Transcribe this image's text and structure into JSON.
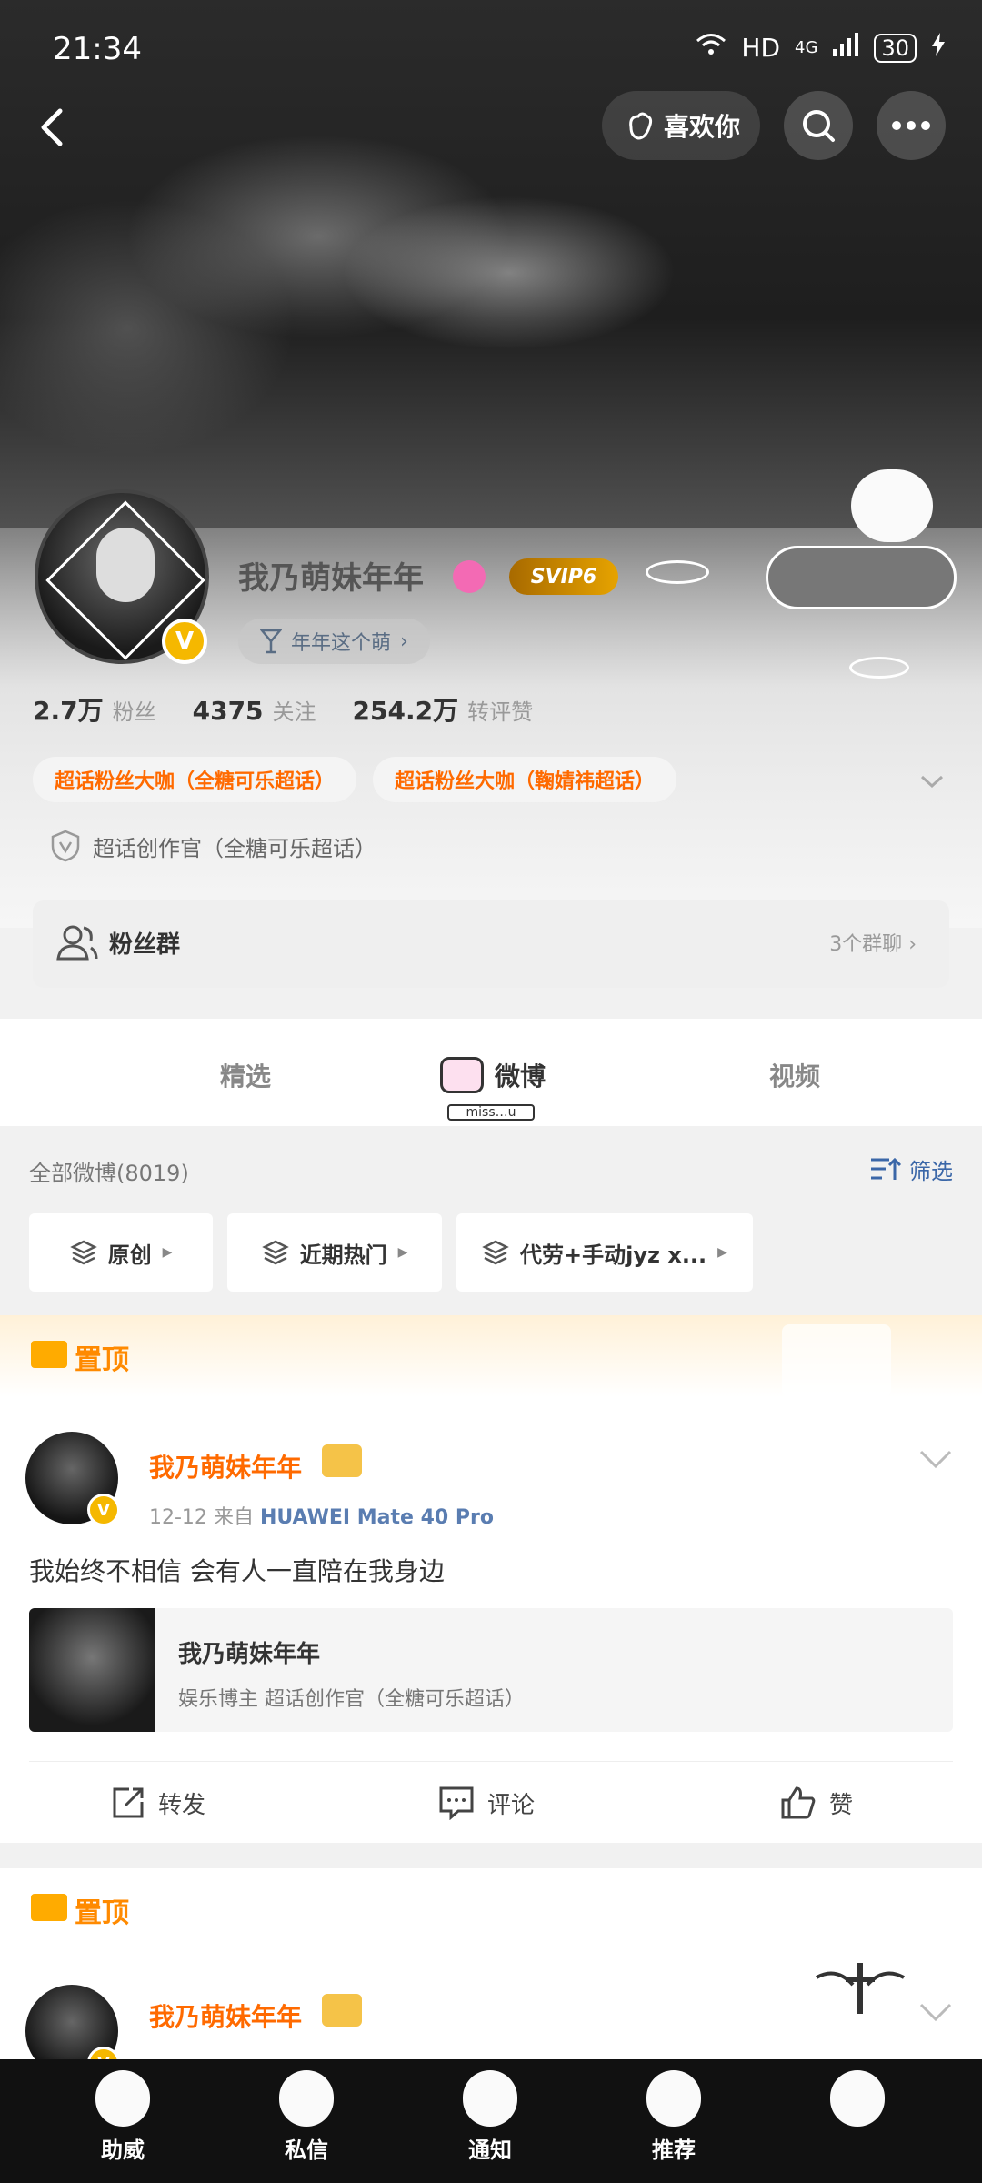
{
  "status_bar": {
    "time": "21:34",
    "network": "HD",
    "signal": "4G",
    "battery": "30"
  },
  "top_bar": {
    "like_label": "喜欢你"
  },
  "profile": {
    "name": "我乃萌妹年年",
    "vip_badge": "SVIP6",
    "signature": "年年这个萌",
    "stats": [
      {
        "value": "2.7万",
        "label": "粉丝"
      },
      {
        "value": "4375",
        "label": "关注"
      },
      {
        "value": "254.2万",
        "label": "转评赞"
      }
    ],
    "chips": [
      "超话粉丝大咖（全糖可乐超话）",
      "超话粉丝大咖（鞠婧祎超话）"
    ],
    "creator": "超话创作官（全糖可乐超话）"
  },
  "fan_group": {
    "title": "粉丝群",
    "count": "3个群聊"
  },
  "tabs": {
    "featured": "精选",
    "weibo": "微博",
    "video": "视频",
    "weibo_tag": "miss…u"
  },
  "filter": {
    "all_posts": "全部微博(8019)",
    "filter_label": "筛选",
    "buttons": [
      "原创",
      "近期热门",
      "代劳+手动jyz x..."
    ]
  },
  "posts": [
    {
      "pin_label": "置顶",
      "author": "我乃萌妹年年",
      "date": "12-12",
      "from_label": "来自",
      "device": "HUAWEI Mate 40 Pro",
      "text": "我始终不相信 会有人一直陪在我身边",
      "quote_title": "我乃萌妹年年",
      "quote_sub": "娱乐博主  超话创作官（全糖可乐超话）",
      "actions": [
        "转发",
        "评论",
        "赞"
      ]
    },
    {
      "pin_label": "置顶",
      "author": "我乃萌妹年年"
    }
  ],
  "bottom_nav": [
    "助威",
    "私信",
    "通知",
    "推荐",
    ""
  ],
  "colors": {
    "accent_orange": "#ff6a00",
    "link_blue": "#3b67a8",
    "verify_gold": "#f5b800"
  }
}
